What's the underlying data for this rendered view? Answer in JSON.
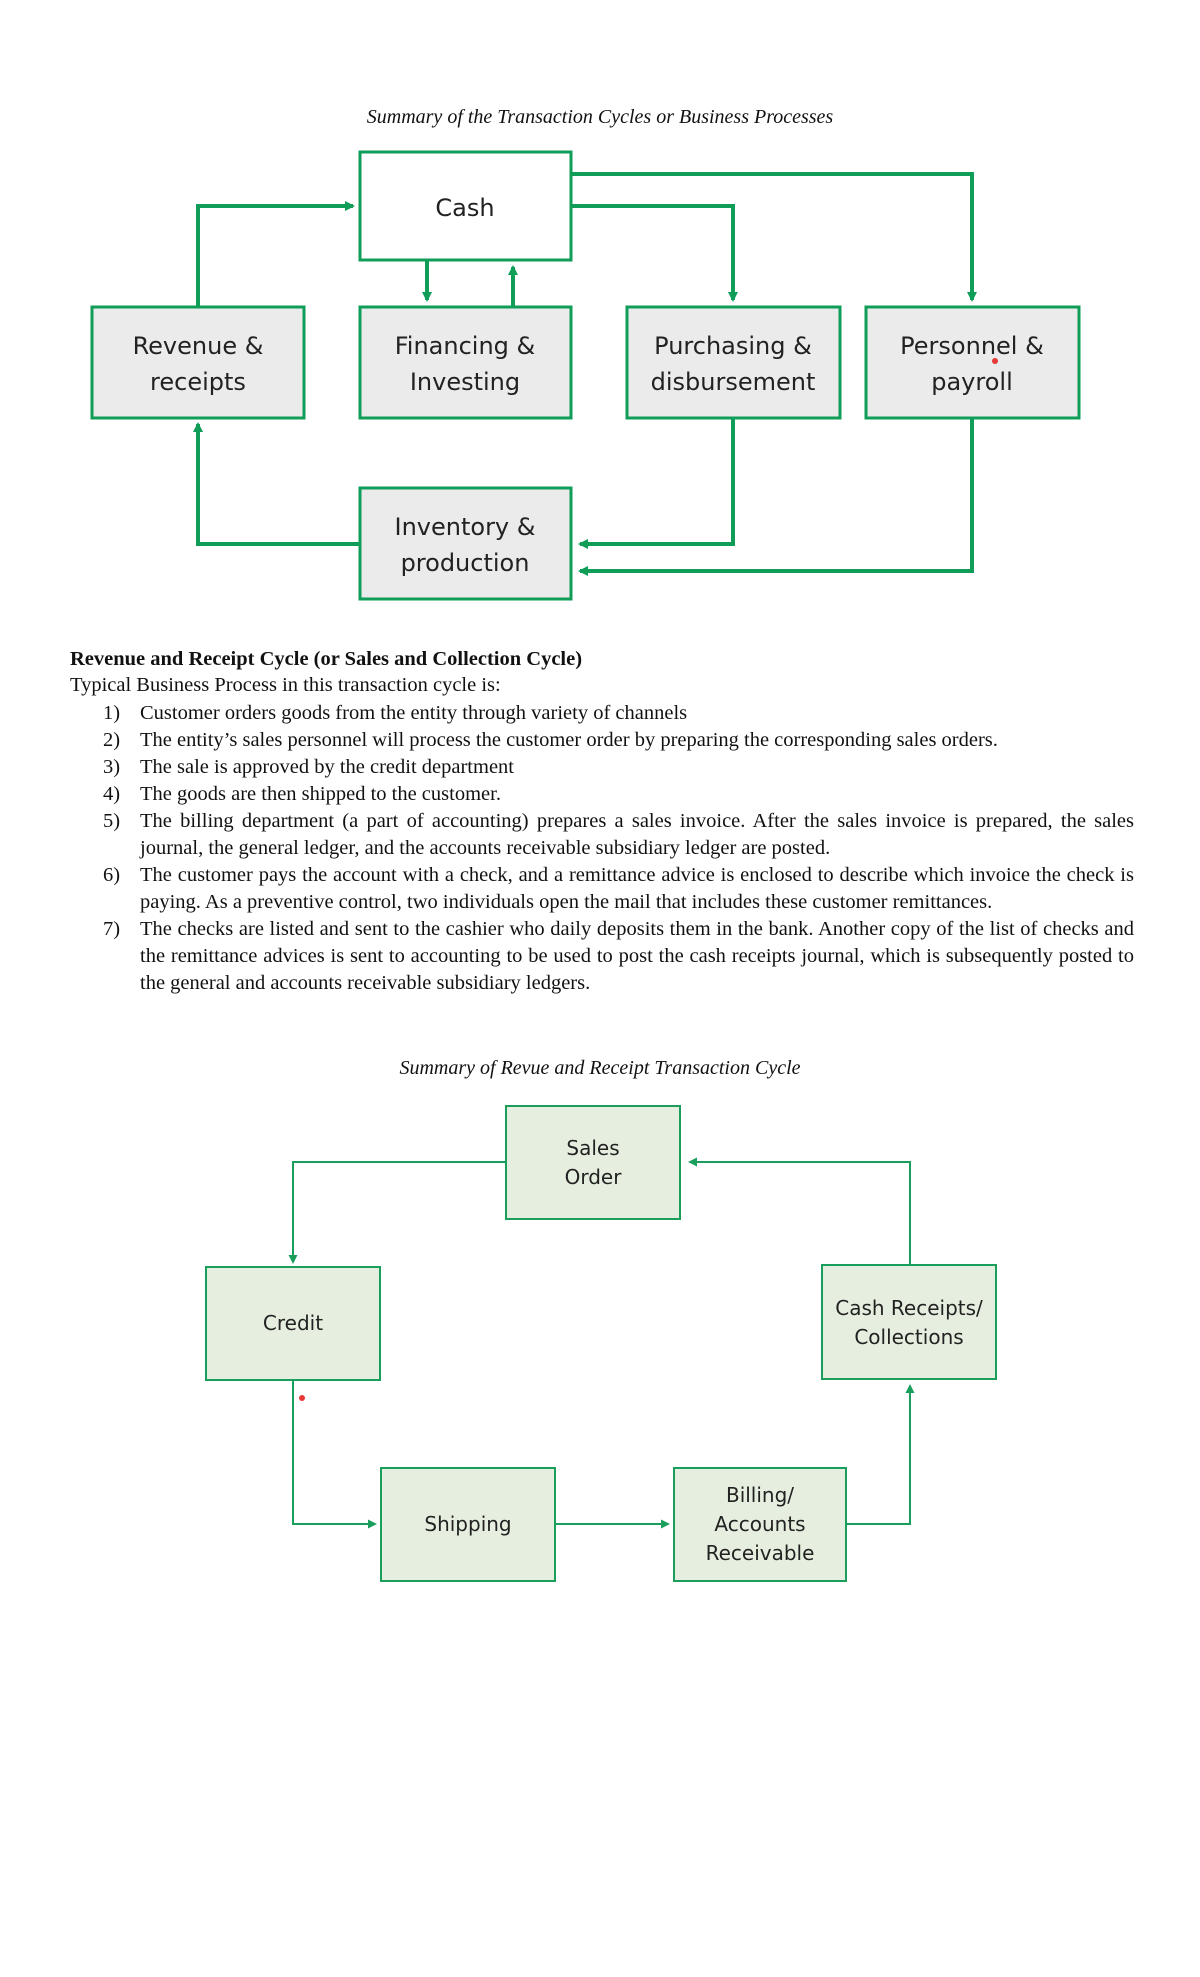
{
  "figure1": {
    "caption": "Summary of the Transaction Cycles or Business Processes",
    "colors": {
      "line": "#0f9d58",
      "box_fill": "#ebebeb",
      "center_fill": "#ffffff"
    },
    "boxes": {
      "cash": [
        "Cash"
      ],
      "revenue": [
        "Revenue &",
        "receipts"
      ],
      "financing": [
        "Financing &",
        "Investing"
      ],
      "purchasing": [
        "Purchasing &",
        "disbursement"
      ],
      "personnel": [
        "Personnel &",
        "payroll"
      ],
      "inventory": [
        "Inventory &",
        "production"
      ]
    },
    "flows": [
      {
        "from": "Revenue & receipts",
        "to": "Cash"
      },
      {
        "from": "Cash",
        "to": "Financing & Investing"
      },
      {
        "from": "Financing & Investing",
        "to": "Cash"
      },
      {
        "from": "Cash",
        "to": "Purchasing & disbursement"
      },
      {
        "from": "Cash",
        "to": "Personnel & payroll"
      },
      {
        "from": "Purchasing & disbursement",
        "to": "Inventory & production"
      },
      {
        "from": "Personnel & payroll",
        "to": "Inventory & production"
      },
      {
        "from": "Inventory & production",
        "to": "Revenue & receipts"
      }
    ]
  },
  "section": {
    "heading": "Revenue and Receipt Cycle (or Sales and Collection Cycle)",
    "intro": "Typical Business Process in this transaction cycle is:",
    "steps": [
      {
        "num": "1)",
        "text": "Customer orders goods from the entity through variety of channels"
      },
      {
        "num": "2)",
        "text": "The entity’s sales personnel will process the customer order by preparing the corresponding sales orders."
      },
      {
        "num": "3)",
        "text": "The sale is approved by the credit department"
      },
      {
        "num": "4)",
        "text": "The goods are then shipped to the customer."
      },
      {
        "num": "5)",
        "text": "The billing department (a part of accounting) prepares a sales invoice. After the sales invoice is prepared, the sales journal, the general ledger, and the accounts receivable subsidiary ledger are posted."
      },
      {
        "num": "6)",
        "text": "The customer pays the account with a check, and a remittance advice is enclosed to describe which invoice the check is paying. As a preventive control, two individuals open the mail that includes these customer remittances."
      },
      {
        "num": "7)",
        "text": "The checks are listed and sent to the cashier who daily deposits them in the bank. Another copy of the list of checks and the remittance advices is sent to accounting to be used to post the cash receipts journal, which is subsequently posted to the general and accounts receivable subsidiary ledgers."
      }
    ]
  },
  "figure2": {
    "caption": "Summary of Revue and Receipt Transaction Cycle",
    "colors": {
      "line": "#1a9e5c",
      "box_fill": "#e6efdf"
    },
    "boxes": {
      "sales_order": [
        "Sales",
        "Order"
      ],
      "credit": [
        "Credit"
      ],
      "cash_receipts": [
        "Cash Receipts/",
        "Collections"
      ],
      "shipping": [
        "Shipping"
      ],
      "billing": [
        "Billing/",
        "Accounts",
        "Receivable"
      ]
    },
    "flows": [
      {
        "from": "Sales Order",
        "to": "Credit"
      },
      {
        "from": "Credit",
        "to": "Shipping"
      },
      {
        "from": "Shipping",
        "to": "Billing/Accounts Receivable"
      },
      {
        "from": "Billing/Accounts Receivable",
        "to": "Cash Receipts/Collections"
      },
      {
        "from": "Cash Receipts/Collections",
        "to": "Sales Order"
      }
    ]
  }
}
